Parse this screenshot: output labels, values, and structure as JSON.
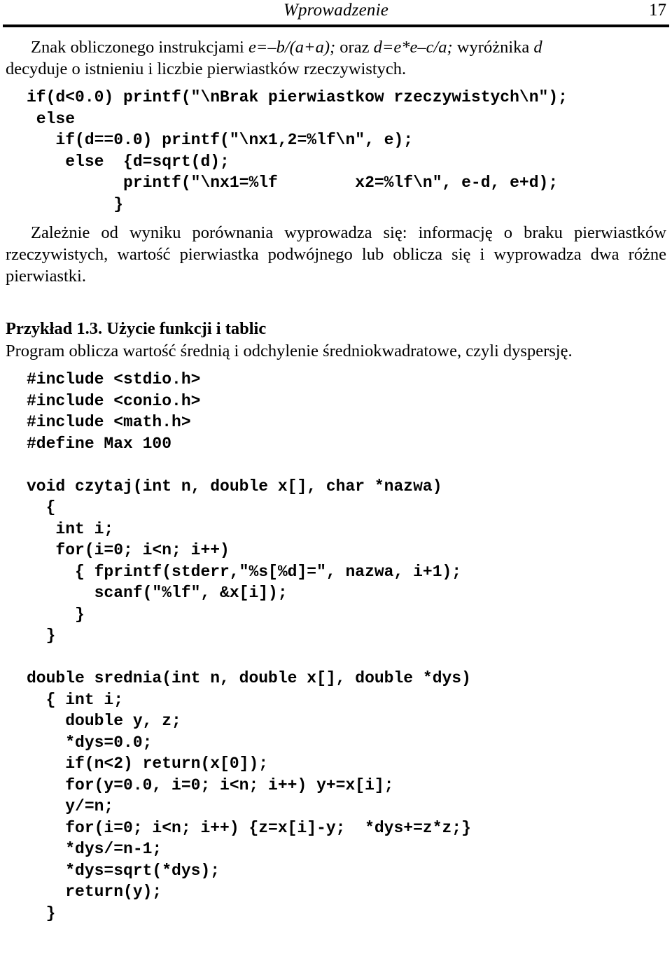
{
  "header": {
    "title": "Wprowadzenie",
    "page_number": "17"
  },
  "intro_paragraph": {
    "lead": "Znak obliczonego instrukcjami ",
    "formula_1": "e=–b/(a+a);",
    "middle": " oraz ",
    "formula_2": "d=e*e–c/a;",
    "tail": " wyróżnika ",
    "tail_var": "d",
    "line2": "decyduje o istnieniu i liczbie pierwiastków rzeczywistych."
  },
  "code_block_1": "if(d<0.0) printf(\"\\nBrak pierwiastkow rzeczywistych\\n\");\n else\n   if(d==0.0) printf(\"\\nx1,2=%lf\\n\", e);\n    else  {d=sqrt(d);\n          printf(\"\\nx1=%lf        x2=%lf\\n\", e-d, e+d);\n         }",
  "explanation_paragraph": "Zależnie od wyniku porównania wyprowadza się: informację o braku pierwiastków rzeczywistych, wartość pierwiastka podwójnego lub oblicza się i wyprowadza dwa różne pierwiastki.",
  "example": {
    "heading": "Przykład 1.3. Użycie funkcji i tablic",
    "description": "Program oblicza wartość średnią i odchylenie średniokwadratowe, czyli dyspersję."
  },
  "code_block_2": "#include <stdio.h>\n#include <conio.h>\n#include <math.h>\n#define Max 100\n\nvoid czytaj(int n, double x[], char *nazwa)\n  {\n   int i;\n   for(i=0; i<n; i++)\n     { fprintf(stderr,\"%s[%d]=\", nazwa, i+1);\n       scanf(\"%lf\", &x[i]);\n     }\n  }\n\ndouble srednia(int n, double x[], double *dys)\n  { int i;\n    double y, z;\n    *dys=0.0;\n    if(n<2) return(x[0]);\n    for(y=0.0, i=0; i<n; i++) y+=x[i];\n    y/=n;\n    for(i=0; i<n; i++) {z=x[i]-y;  *dys+=z*z;}\n    *dys/=n-1;\n    *dys=sqrt(*dys);\n    return(y);\n  }"
}
